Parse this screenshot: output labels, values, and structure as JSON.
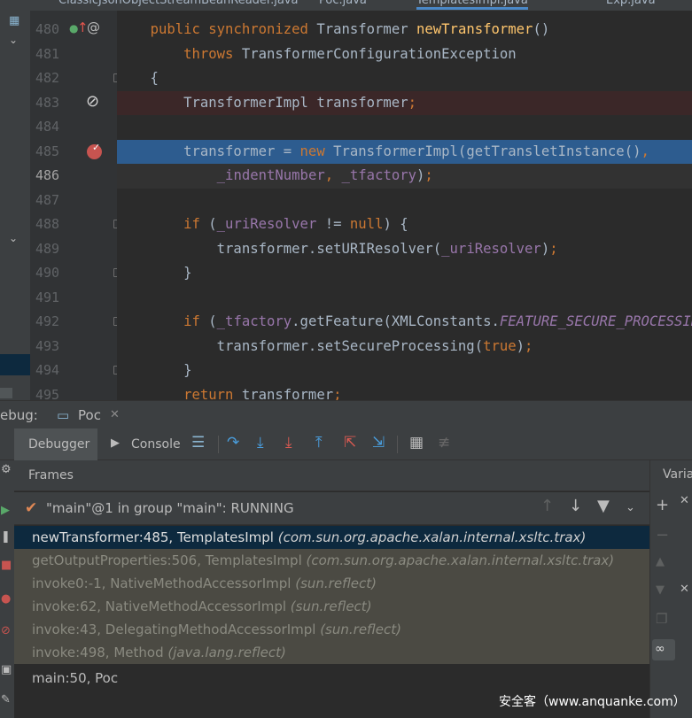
{
  "editor": {
    "tabs": [
      "ClassicJsonObjectStreamBeanReader.java",
      "Poc.java",
      "TemplatesImpl.java",
      "Exp.java"
    ],
    "lines": [
      {
        "num": "480",
        "segments": [
          [
            "",
            "    "
          ],
          [
            "kw",
            "public synchronized "
          ],
          [
            "",
            "Transformer "
          ],
          [
            "fn",
            "newTransformer"
          ],
          [
            "",
            "()"
          ]
        ]
      },
      {
        "num": "481",
        "segments": [
          [
            "",
            "        "
          ],
          [
            "kw",
            "throws "
          ],
          [
            "",
            "TransformerConfigurationException"
          ]
        ]
      },
      {
        "num": "482",
        "segments": [
          [
            "",
            "    {"
          ]
        ]
      },
      {
        "num": "483",
        "segments": [
          [
            "",
            "        TransformerImpl transformer"
          ],
          [
            "kw",
            ";"
          ]
        ]
      },
      {
        "num": "484",
        "segments": [
          [
            "",
            ""
          ]
        ]
      },
      {
        "num": "485",
        "segments": [
          [
            "",
            "        transformer = "
          ],
          [
            "kw",
            "new "
          ],
          [
            "",
            "TransformerImpl(getTransletInstance()"
          ],
          [
            "kw",
            ","
          ]
        ]
      },
      {
        "num": "486",
        "segments": [
          [
            "",
            "            "
          ],
          [
            "fld",
            "_indentNumber"
          ],
          [
            "kw",
            ", "
          ],
          [
            "fld",
            "_tfactory"
          ],
          [
            "",
            ")"
          ],
          [
            "kw",
            ";"
          ]
        ]
      },
      {
        "num": "487",
        "segments": [
          [
            "",
            ""
          ]
        ]
      },
      {
        "num": "488",
        "segments": [
          [
            "",
            "        "
          ],
          [
            "kw",
            "if "
          ],
          [
            "",
            "("
          ],
          [
            "fld",
            "_uriResolver "
          ],
          [
            "",
            "!= "
          ],
          [
            "kw",
            "null"
          ],
          [
            "",
            ") {"
          ]
        ]
      },
      {
        "num": "489",
        "segments": [
          [
            "",
            "            transformer.setURIResolver("
          ],
          [
            "fld",
            "_uriResolver"
          ],
          [
            "",
            ")"
          ],
          [
            "kw",
            ";"
          ]
        ]
      },
      {
        "num": "490",
        "segments": [
          [
            "",
            "        }"
          ]
        ]
      },
      {
        "num": "491",
        "segments": [
          [
            "",
            ""
          ]
        ]
      },
      {
        "num": "492",
        "segments": [
          [
            "",
            "        "
          ],
          [
            "kw",
            "if "
          ],
          [
            "",
            "("
          ],
          [
            "fld",
            "_tfactory"
          ],
          [
            "",
            ".getFeature(XMLConstants."
          ],
          [
            "ital",
            "FEATURE_SECURE_PROCESSING"
          ],
          [
            "",
            ")) {"
          ]
        ]
      },
      {
        "num": "493",
        "segments": [
          [
            "",
            "            transformer.setSecureProcessing("
          ],
          [
            "kw",
            "true"
          ],
          [
            "",
            ")"
          ],
          [
            "kw",
            ";"
          ]
        ]
      },
      {
        "num": "494",
        "segments": [
          [
            "",
            "        }"
          ]
        ]
      },
      {
        "num": "495",
        "segments": [
          [
            "",
            "        "
          ],
          [
            "kw",
            "return "
          ],
          [
            "",
            "transformer"
          ],
          [
            "kw",
            ";"
          ]
        ]
      }
    ],
    "gutter_marks": {
      "480": "@",
      "483": "⊘",
      "485": "breakpoint"
    }
  },
  "debug": {
    "title": "ebug:",
    "run_tab": "Poc",
    "tabs": {
      "debugger": "Debugger",
      "console": "Console"
    },
    "frames_header": "Frames",
    "variables_header": "Varia",
    "thread": "\"main\"@1 in group \"main\": RUNNING",
    "frames": [
      {
        "method": "newTransformer:485, TemplatesImpl ",
        "pkg": "(com.sun.org.apache.xalan.internal.xsltc.trax)",
        "kind": "sel"
      },
      {
        "method": "getOutputProperties:506, TemplatesImpl ",
        "pkg": "(com.sun.org.apache.xalan.internal.xsltc.trax)",
        "kind": "lib"
      },
      {
        "method": "invoke0:-1, NativeMethodAccessorImpl ",
        "pkg": "(sun.reflect)",
        "kind": "lib"
      },
      {
        "method": "invoke:62, NativeMethodAccessorImpl ",
        "pkg": "(sun.reflect)",
        "kind": "lib"
      },
      {
        "method": "invoke:43, DelegatingMethodAccessorImpl ",
        "pkg": "(sun.reflect)",
        "kind": "lib"
      },
      {
        "method": "invoke:498, Method ",
        "pkg": "(java.lang.reflect)",
        "kind": "lib"
      },
      {
        "method": "main:50, Poc",
        "pkg": "",
        "kind": "norm"
      }
    ]
  },
  "watermark": "安全客（www.anquanke.com）",
  "colors": {
    "keyword": "#cc7832",
    "method": "#ffc66d",
    "field": "#9876aa",
    "text": "#a9b7c6",
    "exec_line": "#2d5c8f",
    "selected_frame": "#0d293e",
    "library_frame": "#4b4a43"
  }
}
